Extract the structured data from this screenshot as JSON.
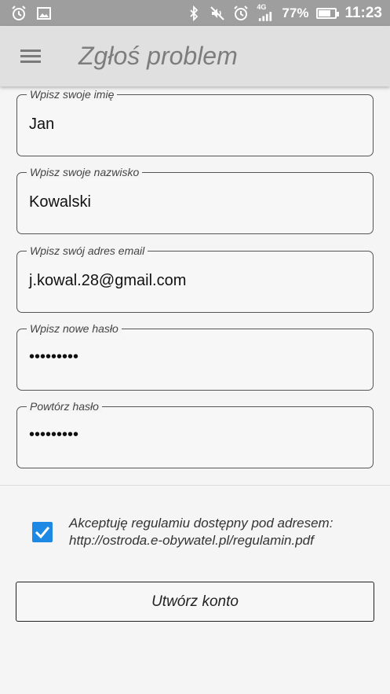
{
  "status_bar": {
    "network": "4G",
    "battery": "77%",
    "battery_level": 0.77,
    "time": "11:23",
    "icons": [
      "alarm-icon",
      "image-icon",
      "bluetooth-icon",
      "mute-icon",
      "alarm-icon",
      "signal-icon",
      "battery-icon"
    ]
  },
  "app_bar": {
    "title": "Zgłoś problem"
  },
  "form": {
    "first_name": {
      "label": "Wpisz swoje imię",
      "value": "Jan"
    },
    "last_name": {
      "label": "Wpisz swoje nazwisko",
      "value": "Kowalski"
    },
    "email": {
      "label": "Wpisz swój adres email",
      "value": "j.kowal.28@gmail.com"
    },
    "password": {
      "label": "Wpisz nowe hasło",
      "value": "•••••••••"
    },
    "password_repeat": {
      "label": "Powtórz hasło",
      "value": "•••••••••"
    }
  },
  "terms": {
    "checked": true,
    "line1": "Akceptuję regulamiu dostępny pod adresem:",
    "line2": "http://ostroda.e-obywatel.pl/regulamin.pdf"
  },
  "actions": {
    "create_account_label": "Utwórz konto"
  },
  "colors": {
    "status_bar": "#9e9e9e",
    "app_bar": "#e0e0e0",
    "checkbox": "#1e88e5",
    "background": "#f5f5f5"
  }
}
